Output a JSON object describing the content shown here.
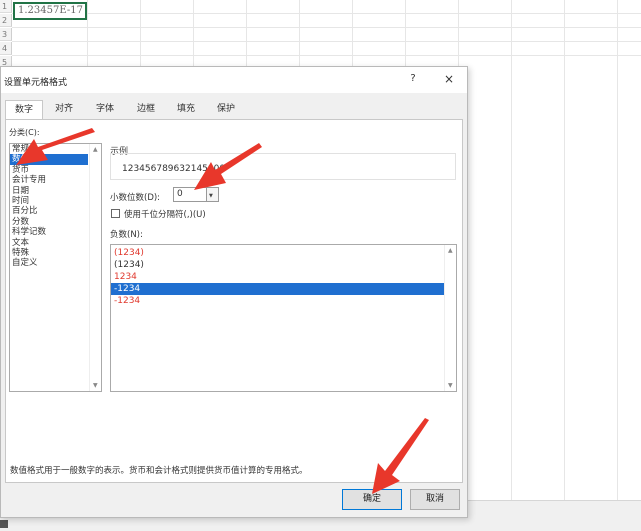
{
  "sheet": {
    "row_numbers": [
      "1",
      "2",
      "3",
      "4",
      "5"
    ],
    "cell_a1": "1.23457E-17"
  },
  "dialog": {
    "title": "设置单元格格式",
    "help": "?",
    "close": "×",
    "tabs": [
      "数字",
      "对齐",
      "字体",
      "边框",
      "填充",
      "保护"
    ],
    "active_tab": "数字",
    "category_label": "分类(C):",
    "categories": [
      "常规",
      "数值",
      "货币",
      "会计专用",
      "日期",
      "时间",
      "百分比",
      "分数",
      "科学记数",
      "文本",
      "特殊",
      "自定义"
    ],
    "selected_category": "数值",
    "sample_label": "示例",
    "sample_value": "123456789632145000",
    "decimal_label": "小数位数(D):",
    "decimal_value": "0",
    "separator_label": "使用千位分隔符(,)(U)",
    "separator_checked": false,
    "negative_label": "负数(N):",
    "negative_options": [
      "(1234)",
      "(1234)",
      "1234",
      "-1234",
      "-1234"
    ],
    "negative_selected_index": 3,
    "description": "数值格式用于一般数字的表示。货币和会计格式则提供货币值计算的专用格式。",
    "ok": "确定",
    "cancel": "取消"
  },
  "colors": {
    "selection": "#1f6fd0",
    "negative_red": "#e0392e",
    "annotation_arrow": "#e8372b",
    "cell_border": "#217346"
  }
}
